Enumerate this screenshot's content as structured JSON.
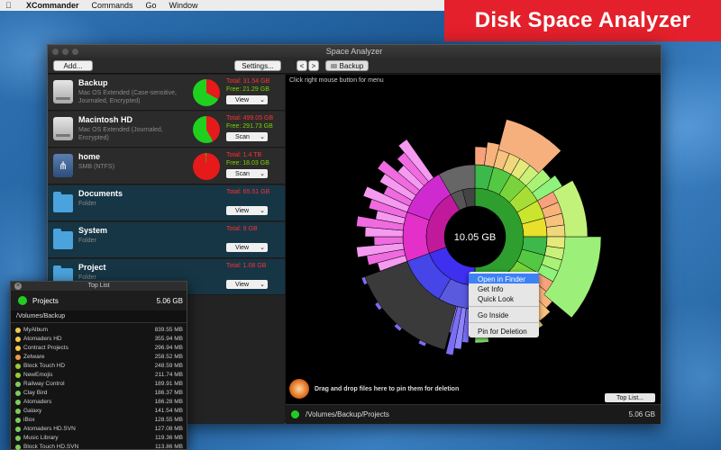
{
  "menubar": {
    "apple": "",
    "app": "XCommander",
    "items": [
      "Commands",
      "Go",
      "Window"
    ]
  },
  "banner": {
    "text": "Disk Space Analyzer"
  },
  "window": {
    "title": "Space Analyzer",
    "toolbar": {
      "add": "Add...",
      "settings": "Settings...",
      "back": "<",
      "forward": ">",
      "path": "Backup"
    }
  },
  "drives": [
    {
      "name": "Backup",
      "desc": "Mac OS Extended (Case-sensitive, Journaled, Encrypted)",
      "total": "Total: 31.54 GB",
      "free": "Free: 21.29 GB",
      "button": "View",
      "used_fraction": 0.33,
      "type": "hdd"
    },
    {
      "name": "Macintosh HD",
      "desc": "Mac OS Extended (Journaled, Encrypted)",
      "total": "Total: 499.05 GB",
      "free": "Free: 291.73 GB",
      "button": "Scan",
      "used_fraction": 0.42,
      "type": "hdd"
    },
    {
      "name": "home",
      "desc": "SMB (NTFS)",
      "total": "Total: 1.4 TB",
      "free": "Free: 18.03 GB",
      "button": "Scan",
      "used_fraction": 0.99,
      "type": "net"
    },
    {
      "name": "Documents",
      "desc": "Folder",
      "total": "Total: 65.51 GB",
      "free": "",
      "button": "View",
      "type": "folder"
    },
    {
      "name": "System",
      "desc": "Folder",
      "total": "Total: 9 GB",
      "free": "",
      "button": "View",
      "type": "folder"
    },
    {
      "name": "Project",
      "desc": "Folder",
      "total": "Total: 1.08 GB",
      "free": "",
      "button": "View",
      "type": "folder"
    }
  ],
  "center": {
    "hint": "Click right mouse button for menu",
    "center_label": "10.05 GB",
    "context_menu": [
      "Open in Finder",
      "Get Info",
      "Quick Look",
      "Go Inside",
      "Pin for Deletion"
    ],
    "drop_text": "Drag and drop files here to pin them for deletion",
    "toplist_button": "Top List...",
    "status_path": "/Volumes/Backup/Projects",
    "status_size": "5.06 GB"
  },
  "toplist": {
    "title": "Top List",
    "close": "×",
    "head_name": "Projects",
    "head_size": "5.06 GB",
    "path": "/Volumes/Backup",
    "rows": [
      {
        "name": "MyAlbum",
        "size": "839.55 MB",
        "color": "#f2c94c"
      },
      {
        "name": "Atomaders HD",
        "size": "355.94 MB",
        "color": "#f2c94c"
      },
      {
        "name": "Contract Projects",
        "size": "296.94 MB",
        "color": "#f2c94c"
      },
      {
        "name": "Zetware",
        "size": "258.52 MB",
        "color": "#f2994a"
      },
      {
        "name": "Block Touch HD",
        "size": "248.59 MB",
        "color": "#9acd32"
      },
      {
        "name": "NewEmojis",
        "size": "211.74 MB",
        "color": "#9acd32"
      },
      {
        "name": "Railway Control",
        "size": "189.91 MB",
        "color": "#7ccd5a"
      },
      {
        "name": "Clay Bird",
        "size": "186.37 MB",
        "color": "#7ccd5a"
      },
      {
        "name": "Atomaders",
        "size": "186.28 MB",
        "color": "#7ccd5a"
      },
      {
        "name": "Galaxy",
        "size": "141.54 MB",
        "color": "#7ccd5a"
      },
      {
        "name": "iBox",
        "size": "128.55 MB",
        "color": "#7ccd5a"
      },
      {
        "name": "Atomaders HD.SVN",
        "size": "127.08 MB",
        "color": "#7ccd5a"
      },
      {
        "name": "Music Library",
        "size": "119.36 MB",
        "color": "#7ccd5a"
      },
      {
        "name": "Block Touch HD.SVN",
        "size": "113.86 MB",
        "color": "#7ccd5a"
      }
    ]
  }
}
